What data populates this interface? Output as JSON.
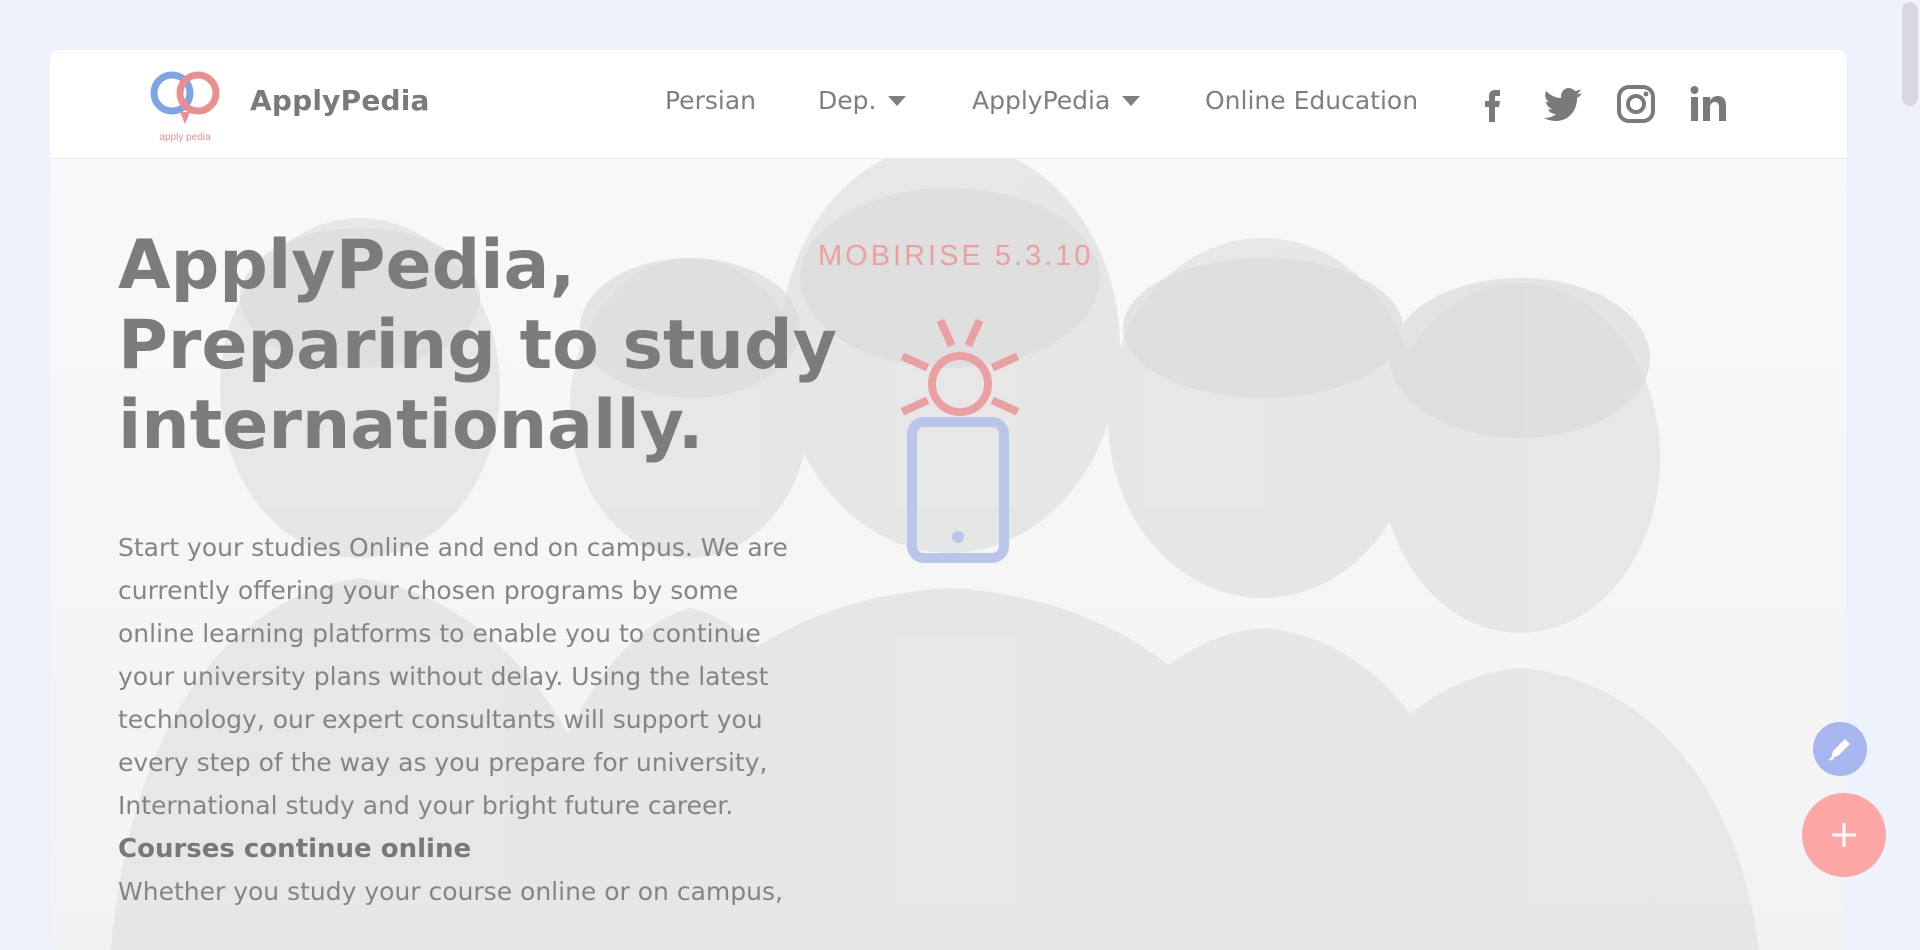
{
  "nav": {
    "brand": "ApplyPedia",
    "logo_text": "apply pedia",
    "items": [
      {
        "label": "Persian",
        "dropdown": false
      },
      {
        "label": "Dep.",
        "dropdown": true
      },
      {
        "label": "ApplyPedia",
        "dropdown": true
      },
      {
        "label": "Online Education",
        "dropdown": false
      }
    ],
    "social_icons": [
      "facebook-icon",
      "twitter-icon",
      "instagram-icon",
      "linkedin-icon"
    ]
  },
  "hero": {
    "title": "ApplyPedia, Preparing to study internationally.",
    "text": "Start your studies Online and end on campus. We are currently offering your chosen programs by some online learning platforms to enable you to continue your university plans without delay. Using the latest technology, our expert consultants will support you every step of the way as you prepare for university, International study and your bright future career.",
    "subheading": "Courses continue online",
    "subtext": "Whether you study your course online or on campus,"
  },
  "overlay": {
    "mobirise_label": "MOBIRISE  5.3.10"
  },
  "colors": {
    "background": "#eef2fc",
    "fab_edit": "#a7b6ef",
    "fab_add": "#fca6a6",
    "accent_red": "#eaa0a0",
    "accent_blue": "#b9c6ea"
  }
}
